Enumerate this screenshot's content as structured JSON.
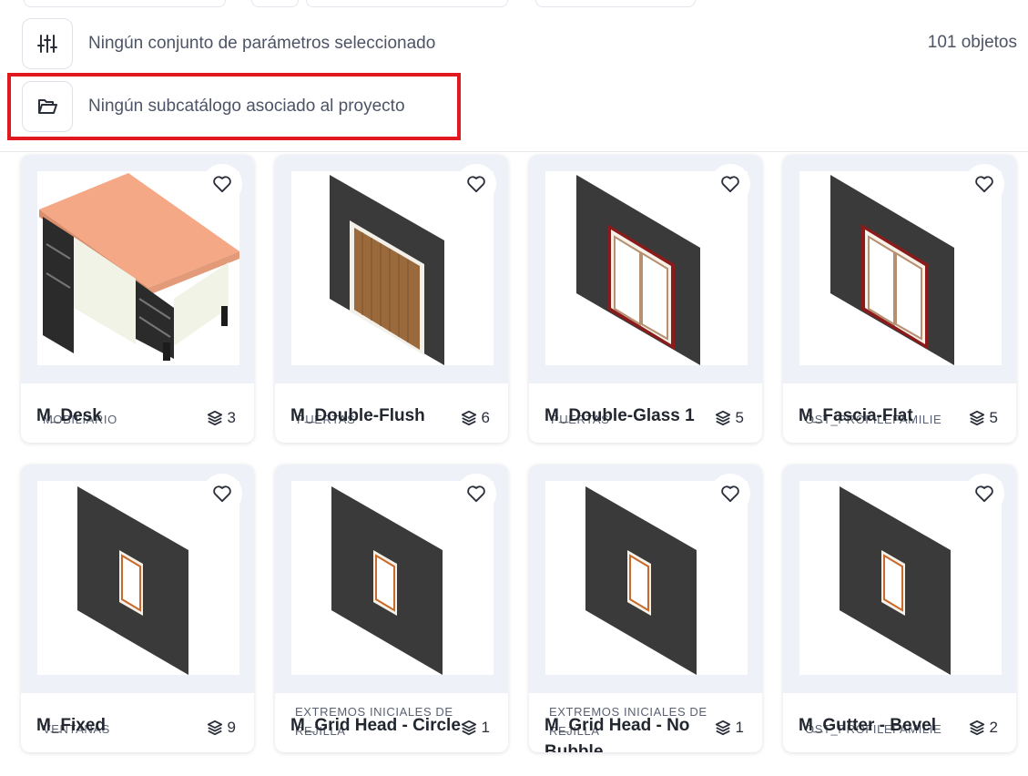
{
  "toolbar": {
    "params_text": "Ningún conjunto de parámetros seleccionado",
    "object_count": "101 objetos",
    "subcatalog_text": "Ningún subcatálogo asociado al proyecto",
    "params_icon": "sliders-icon",
    "subcatalog_icon": "folder-open-icon",
    "highlight_color": "#e0191f"
  },
  "items": [
    {
      "name": "M_Desk",
      "category": "MOBILIARIO",
      "count": "3",
      "thumb": "desk"
    },
    {
      "name": "M_Double-Flush",
      "category": "PUERTAS",
      "count": "6",
      "thumb": "door-flush"
    },
    {
      "name": "M_Double-Glass 1",
      "category": "PUERTAS",
      "count": "5",
      "thumb": "door-glass"
    },
    {
      "name": "M_Fascia-Flat",
      "category": "OST_PROFILEFAMILIES",
      "count": "5",
      "thumb": "door-glass"
    },
    {
      "name": "M_Fixed",
      "category": "VENTANAS",
      "count": "9",
      "thumb": "window"
    },
    {
      "name": "M_Grid Head - Circle",
      "category": "EXTREMOS INICIALES DE REJILLA",
      "count": "1",
      "thumb": "window"
    },
    {
      "name": "M_Grid Head - No Bubble",
      "category": "EXTREMOS INICIALES DE REJILLA",
      "count": "1",
      "thumb": "window"
    },
    {
      "name": "M_Gutter - Bevel",
      "category": "OST_PROFILEFAMILIES",
      "count": "2",
      "thumb": "window"
    }
  ]
}
